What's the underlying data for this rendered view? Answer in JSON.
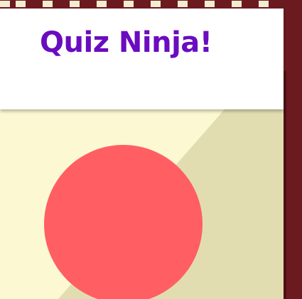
{
  "header": {
    "title": "Quiz Ninja!"
  },
  "colors": {
    "frame": "#6b1a1f",
    "title": "#6a0cbf",
    "stage_light": "#fbf8d2",
    "stage_shade": "#e2ddb0",
    "target": "#ff5f63",
    "stripe": "#f4ecd0"
  }
}
